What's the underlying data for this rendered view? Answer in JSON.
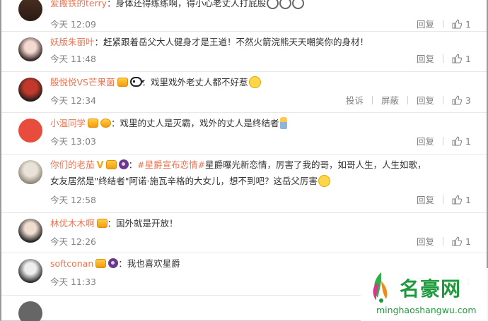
{
  "comments": [
    {
      "user": "爱搬铁的terry",
      "badges": [],
      "sep": "：",
      "text": "身体还得练练啊，得小心老丈人打屁股",
      "emojis": [
        "scared",
        "scared",
        "scared"
      ],
      "time": "今天 12:09",
      "actions": [
        "回复"
      ],
      "likes": "1"
    },
    {
      "user": "妖版朱丽叶",
      "badges": [],
      "sep": "：",
      "text": "赶紧跟着岳父大人健身才是王道！不然火箭浣熊天天嘲笑你的身材！",
      "emojis": [],
      "time": "今天 11:48",
      "actions": [
        "回复"
      ],
      "likes": "1"
    },
    {
      "user": "殷悦悦VS芒果菌",
      "badges": [
        "gold",
        "panda"
      ],
      "sep": "：",
      "text": "戏里戏外老丈人都不好惹",
      "emojis": [
        "laugh"
      ],
      "time": "今天 12:34",
      "actions": [
        "投诉",
        "屏蔽",
        "回复"
      ],
      "likes": "3"
    },
    {
      "user": "小温同学",
      "badges": [
        "gold",
        "gold"
      ],
      "sep": "：",
      "text": "戏里的丈人是灭霸，戏外的丈人是终结者",
      "emojis": [
        "candle"
      ],
      "time": "今天 13:03",
      "actions": [
        "回复"
      ],
      "likes": "1"
    },
    {
      "user": "你们的老茄",
      "badges": [
        "v",
        "gold",
        "dark"
      ],
      "sep": "：",
      "topic": "#星爵宣布恋情#",
      "text": "星爵曝光新恋情，厉害了我的哥，如哥人生，人生如歌，",
      "text2": "女友居然是\"终结者\"阿诺·施瓦辛格的大女儿，想不到吧？这岳父厉害",
      "emojis": [
        "laugh"
      ],
      "time": "今天 12:58",
      "actions": [
        "回复"
      ],
      "likes": "1"
    },
    {
      "user": "林优木木啊",
      "badges": [
        "gold"
      ],
      "sep": "：",
      "text": "国外就是开放！",
      "emojis": [],
      "time": "今天 12:26",
      "actions": [
        "回复"
      ],
      "likes": "1"
    },
    {
      "user": "softconan",
      "badges": [
        "gold",
        "dark"
      ],
      "sep": "：",
      "text": "我也喜欢星爵",
      "emojis": [],
      "time": "今天 11:33",
      "actions": [
        "回复"
      ],
      "likes": "1"
    }
  ],
  "watermark": {
    "name": "名豪网",
    "url": "minghaoshangwu.com"
  },
  "colors": {
    "username": "#eb7350",
    "meta": "#808080",
    "watermark": "#1e9a3c"
  }
}
